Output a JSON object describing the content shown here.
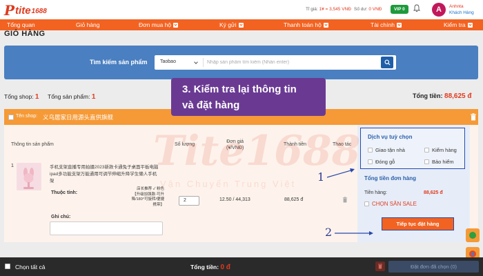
{
  "header": {
    "logo_text": "Tite1688",
    "rate_label": "Tỉ giá:",
    "rate_value": "1¥ = 3,545 VNĐ",
    "balance_label": "Số dư:",
    "balance_value": "0 VNĐ",
    "vip_label": "VIP 0",
    "avatar_initial": "A",
    "user_name": "Anhnta",
    "user_role": "Khách Hàng"
  },
  "nav": {
    "items": [
      {
        "label": "Tổng quan",
        "has_dropdown": false
      },
      {
        "label": "Giỏ hàng",
        "has_dropdown": false
      },
      {
        "label": "Đơn mua hộ",
        "has_dropdown": true
      },
      {
        "label": "Ký gửi",
        "has_dropdown": true
      },
      {
        "label": "Thanh toán hộ",
        "has_dropdown": true
      },
      {
        "label": "Tài chính",
        "has_dropdown": true
      },
      {
        "label": "Kiểm tra",
        "has_dropdown": true
      }
    ]
  },
  "page": {
    "title": "GIỎ HÀNG"
  },
  "search": {
    "label": "Tìm kiếm sản phẩm",
    "source_selected": "Taobao",
    "placeholder": "Nhập sản phẩm tìm kiếm (Nhấn enter)"
  },
  "summary": {
    "shop_total_label": "Tổng shop:",
    "shop_total_value": "1",
    "product_total_label": "Tổng sản phẩm:",
    "product_total_value": "1",
    "grand_total_label": "Tổng tiền:",
    "grand_total_value": "88,625 đ"
  },
  "shop": {
    "name_label": "Tên shop:",
    "name": "义乌居家日用源头直供旗舰",
    "columns": [
      "Thông tin sản phẩm",
      "Số lượng",
      "Đơn giá\n(¥/VNĐ)",
      "Thành tiền",
      "Thao tác"
    ],
    "item": {
      "index": "1",
      "name": "手机支架直播专用拍摄2023新款卡通兔子桌面平板电脑ipad多功能支架万能通用可调节伸缩升降学生懒人手机架",
      "attributes_label": "Thuộc tính:",
      "variant": "店长推荐 ✓ 粉色【升级加强款-可升降/180°可旋转/便捷携带】",
      "note_label": "Ghi chú:",
      "quantity": "2",
      "unit_price": "12.50 / 44,313",
      "line_total": "88,625 đ"
    }
  },
  "services": {
    "title": "Dịch vụ tuỳ chọn",
    "options": [
      "Giao tận nhà",
      "Kiểm hàng",
      "Đóng gỗ",
      "Bảo hiểm"
    ]
  },
  "order_total": {
    "title": "Tổng tiền đơn hàng",
    "goods_label": "Tiền hàng:",
    "goods_value": "88,625 đ",
    "sale_label": "CHỌN SĂN SALE",
    "continue_button": "Tiếp tục đặt hàng"
  },
  "bottom": {
    "select_all": "Chọn tất cả",
    "total_label": "Tổng tiền:",
    "total_value": "0 đ",
    "submit_button": "Đặt đơn đã chọn (0)"
  },
  "tutorial": {
    "callout_line1": "3. Kiểm tra lại thông tin",
    "callout_line2": "và đặt hàng",
    "marker_1": "1",
    "marker_2": "2",
    "watermark_logo": "Tite1688",
    "watermark_text": "Vận Chuyển Trung Việt"
  },
  "colors": {
    "brand_orange": "#f26322",
    "shop_header": "#f59a37",
    "search_banner": "#4a7fc1",
    "price_red": "#e03a1e",
    "callout_purple": "#6a3a93",
    "annotation_blue": "#2947a9"
  }
}
